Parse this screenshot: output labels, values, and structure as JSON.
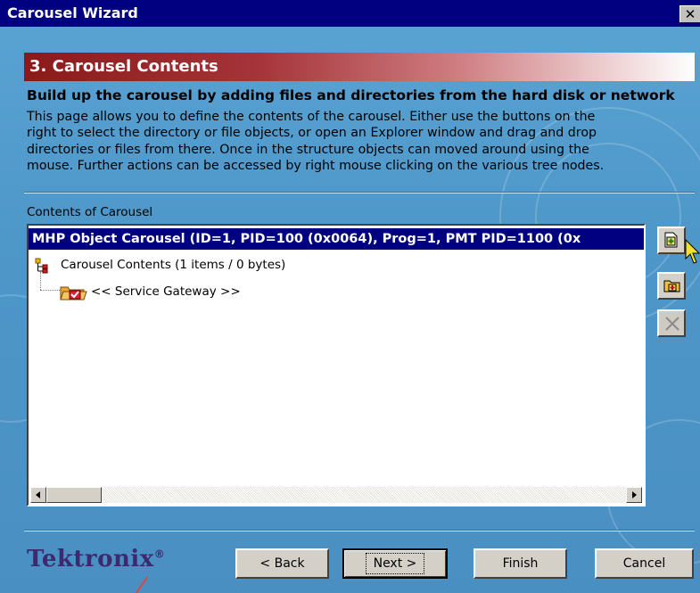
{
  "window": {
    "title": "Carousel Wizard",
    "close_glyph": "✕"
  },
  "step_title": "3. Carousel Contents",
  "heading": "Build up the carousel by adding files and directories from the hard disk or network",
  "description_lines": [
    "This page allows you to define the contents of the carousel. Either use the buttons on the",
    "right to select the directory or file objects, or open an Explorer window and drag and drop",
    "directories or files from there. Once in the structure objects can moved around using the",
    "mouse. Further actions can be accessed by right mouse clicking on the various tree nodes."
  ],
  "contents_label": "Contents of Carousel",
  "tree": {
    "root": "MHP Object Carousel (ID=1, PID=100 (0x0064), Prog=1, PMT PID=1100 (0x",
    "contents_node": "Carousel Contents (1 items / 0 bytes)",
    "gateway_node": "<< Service Gateway >>",
    "icons": {
      "contents": "tree-structure-icon",
      "gateway": "service-gateway-folder-icon"
    }
  },
  "side_buttons": [
    {
      "name": "add-file-button",
      "icon": "add-file-icon",
      "enabled": true
    },
    {
      "name": "add-directory-button",
      "icon": "add-folder-icon",
      "enabled": true
    },
    {
      "name": "delete-button",
      "icon": "delete-x-icon",
      "enabled": false
    }
  ],
  "footer": {
    "logo": "Tektronix",
    "logo_mark": "®",
    "back": "< Back",
    "next": "Next >",
    "finish": "Finish",
    "cancel": "Cancel"
  },
  "colors": {
    "titlebar": "#000080",
    "step_banner": "#8a1a1a",
    "selection": "#000080",
    "background": "#4e97c9",
    "logo": "#3b2a70"
  }
}
